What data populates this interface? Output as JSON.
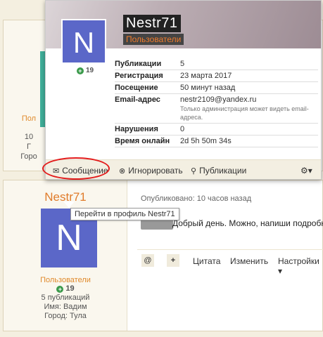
{
  "background_top": {
    "peek_lines": [
      "Пол",
      "10",
      "Г",
      "Горо"
    ]
  },
  "post": {
    "author": "Nestr71",
    "avatar_letter": "N",
    "group": "Пользователи",
    "reputation": "19",
    "publications": "5 публикаций",
    "name_line": "Имя: Вадим",
    "city_line": "Город: Тула",
    "meta": "Опубликовано: 10 часов назад",
    "body": "Добрый день. Можно, напиши подробн",
    "actions": {
      "mention": "@",
      "plus": "+",
      "quote": "Цитата",
      "edit": "Изменить",
      "settings": "Настройки"
    }
  },
  "card": {
    "name": "Nestr71",
    "group": "Пользователи",
    "avatar_letter": "N",
    "reputation": "19",
    "stats": [
      {
        "key": "Публикации",
        "value": "5"
      },
      {
        "key": "Регистрация",
        "value": "23 марта 2017"
      },
      {
        "key": "Посещение",
        "value": "50 минут назад"
      },
      {
        "key": "Email-адрес",
        "value": "nestr2109@yandex.ru",
        "note": "Только администрация может видеть email-адреса."
      },
      {
        "key": "Нарушения",
        "value": "0"
      },
      {
        "key": "Время онлайн",
        "value": "2d 5h 50m 34s"
      }
    ],
    "footer": {
      "message": "Сообщение",
      "ignore": "Игнорировать",
      "publications": "Публикации"
    }
  },
  "tooltip": "Перейти в профиль Nestr71",
  "colors": {
    "accent_orange": "#e07b2a",
    "avatar_blue": "#5b67c8",
    "annotation_red": "#e31b1b"
  }
}
